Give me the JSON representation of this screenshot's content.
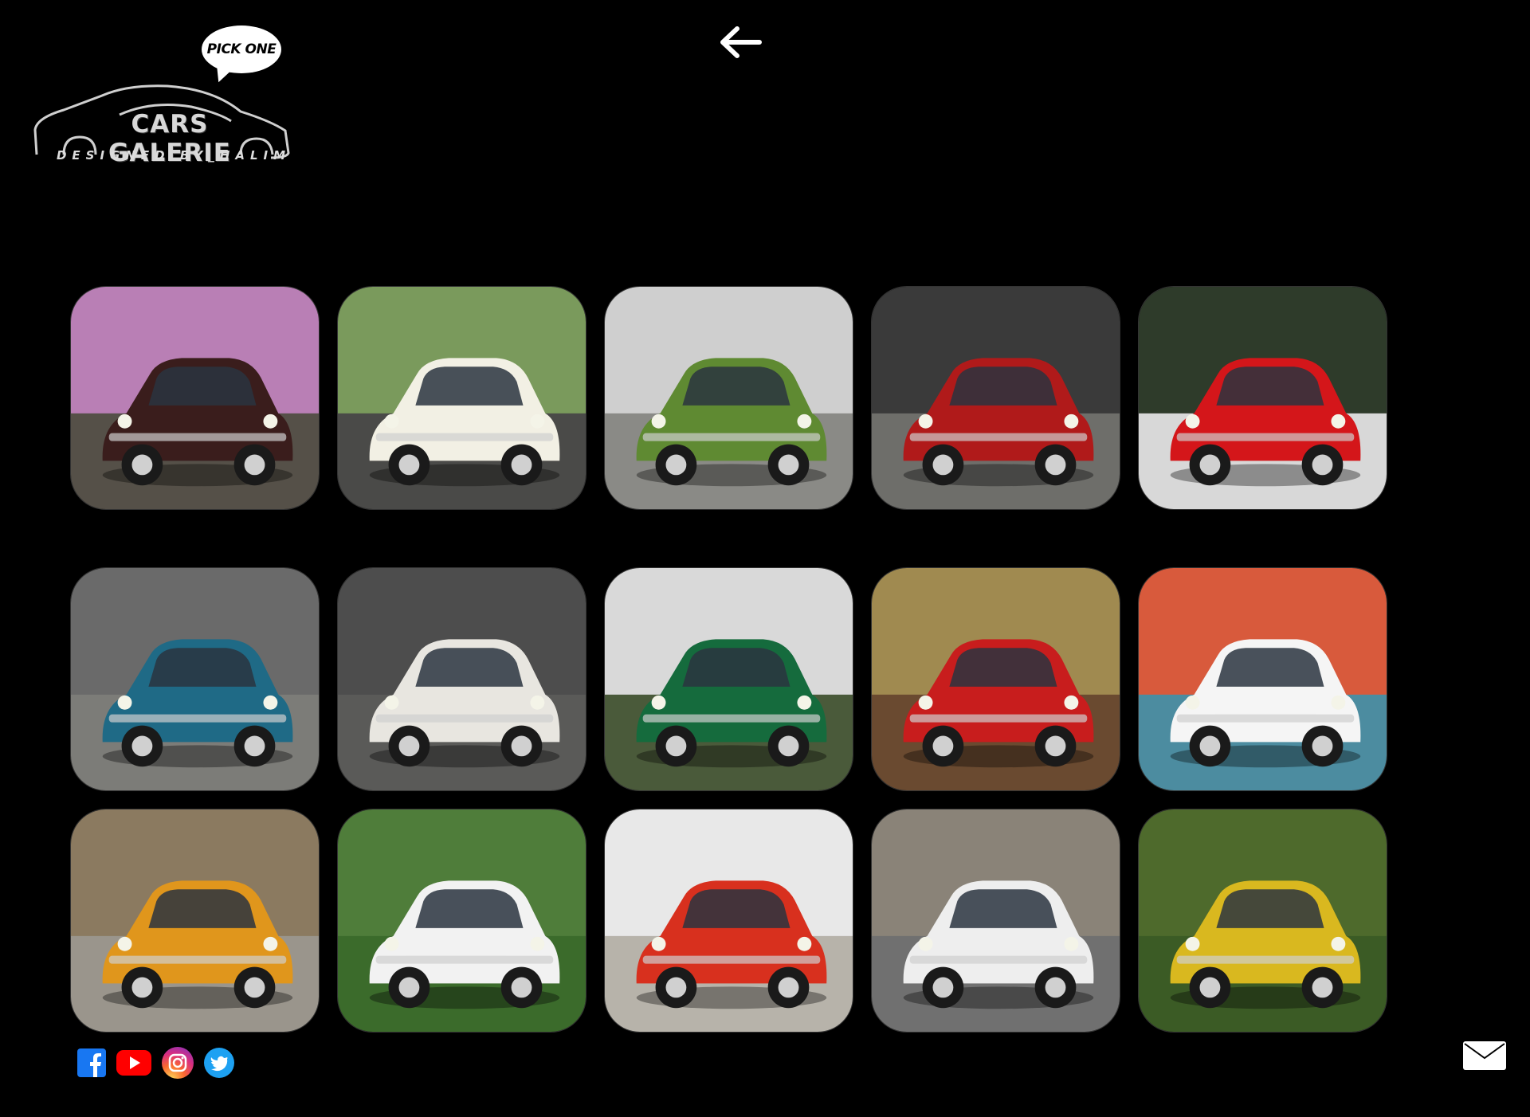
{
  "logo": {
    "bubble_text": "PICK ONE",
    "brand": "CARS GALERIE",
    "designer": "DESIGNED BY_HALIM"
  },
  "navigation": {
    "back_icon": "arrow-left-icon"
  },
  "gallery": {
    "rows": [
      [
        {
          "name": "fiat-seicento-sunset",
          "car_color": "#3a1d1c"
        },
        {
          "name": "fiat-500-jolly-white",
          "car_color": "#f2f0e4"
        },
        {
          "name": "fiat-126-green",
          "car_color": "#5f8a32"
        },
        {
          "name": "fiat-126-red-garage",
          "car_color": "#b01a1a"
        },
        {
          "name": "fiat-500-red-classic",
          "car_color": "#d4161a"
        }
      ],
      [
        {
          "name": "fiat-500-blue-basket",
          "car_color": "#1f6a86"
        },
        {
          "name": "fiat-500c-white-parking",
          "car_color": "#e8e6e0"
        },
        {
          "name": "fiat-600-multipla-green",
          "car_color": "#156b3d"
        },
        {
          "name": "fiat-500-red-basket-rear",
          "car_color": "#c81d1d"
        },
        {
          "name": "fiat-500c-white-harbor",
          "car_color": "#f5f5f5"
        }
      ],
      [
        {
          "name": "fiat-500-orange-church",
          "car_color": "#e0961c"
        },
        {
          "name": "fiat-500c-white-basket",
          "car_color": "#f2f2f2"
        },
        {
          "name": "fiat-punto-red",
          "car_color": "#d8301e"
        },
        {
          "name": "fiat-500c-white-cobblestone",
          "car_color": "#eeeeee"
        },
        {
          "name": "fiat-126-yellow",
          "car_color": "#d9b81f"
        }
      ]
    ]
  },
  "footer": {
    "social": [
      "facebook-icon",
      "youtube-icon",
      "instagram-icon",
      "twitter-icon"
    ],
    "contact_icon": "mail-icon"
  },
  "colors": {
    "background": "#000000",
    "facebook": "#1877f2",
    "youtube": "#ff0000",
    "twitter": "#1da1f2"
  }
}
